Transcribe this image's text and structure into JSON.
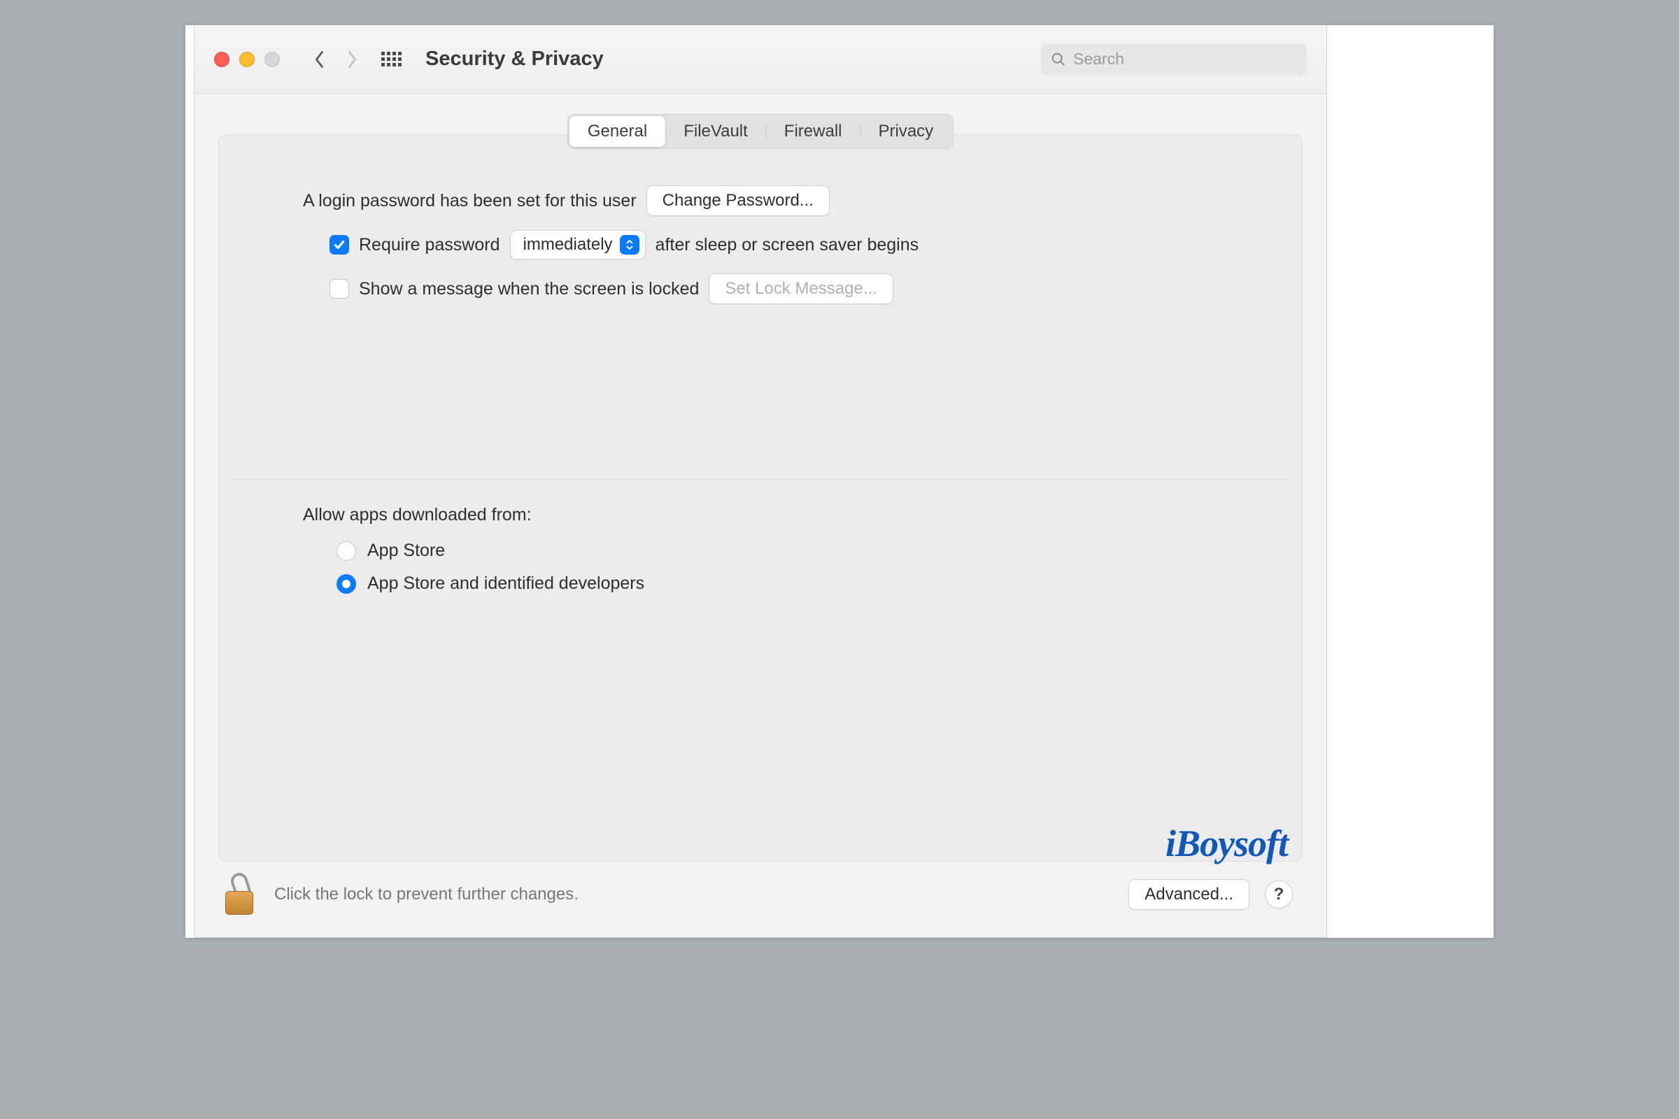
{
  "toolbar": {
    "title": "Security & Privacy",
    "search_placeholder": "Search"
  },
  "tabs": {
    "general": "General",
    "filevault": "FileVault",
    "firewall": "Firewall",
    "privacy": "Privacy",
    "active": "general"
  },
  "login": {
    "password_set_text": "A login password has been set for this user",
    "change_password_btn": "Change Password...",
    "require_password_label": "Require password",
    "require_password_checked": true,
    "delay_dropdown_value": "immediately",
    "after_sleep_text": "after sleep or screen saver begins",
    "show_message_label": "Show a message when the screen is locked",
    "show_message_checked": false,
    "set_lock_message_btn": "Set Lock Message..."
  },
  "allow_apps": {
    "section_label": "Allow apps downloaded from:",
    "option_app_store": "App Store",
    "option_identified": "App Store and identified developers",
    "selected": "identified"
  },
  "footer": {
    "lock_text": "Click the lock to prevent further changes.",
    "advanced_btn": "Advanced...",
    "help_btn": "?"
  },
  "watermark": "iBoysoft"
}
